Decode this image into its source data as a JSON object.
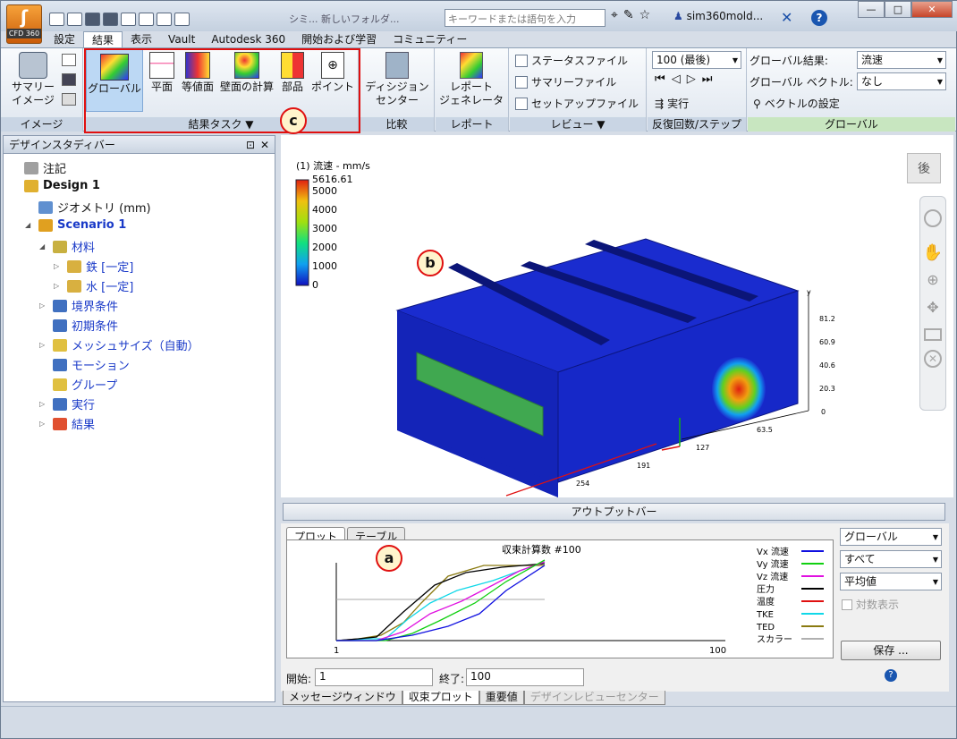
{
  "app": {
    "name": "CFD 360",
    "title_partial": "シミ... 新しいフォルダ..."
  },
  "search": {
    "placeholder": "キーワードまたは語句を入力"
  },
  "user": {
    "name": "sim360mold..."
  },
  "menu": [
    {
      "label": "設定"
    },
    {
      "label": "結果"
    },
    {
      "label": "表示"
    },
    {
      "label": "Vault"
    },
    {
      "label": "Autodesk 360"
    },
    {
      "label": "開始および学習"
    },
    {
      "label": "コミュニティー"
    }
  ],
  "ribbon": {
    "image_group": {
      "label": "イメージ",
      "summary_btn": "サマリー\nイメージ",
      "summary_l1": "サマリー",
      "summary_l2": "イメージ"
    },
    "result_tasks": {
      "label": "結果タスク ▼",
      "buttons": [
        "グローバル",
        "平面",
        "等値面",
        "壁面の計算",
        "部品",
        "ポイント"
      ]
    },
    "compare": {
      "label": "比較",
      "btn_l1": "ディシジョン",
      "btn_l2": "センター"
    },
    "report": {
      "label": "レポート",
      "btn_l1": "レポート",
      "btn_l2": "ジェネレータ"
    },
    "review": {
      "label": "レビュー ▼",
      "items": [
        "ステータスファイル",
        "サマリーファイル",
        "セットアップファイル"
      ]
    },
    "iter": {
      "label": "反復回数/ステップ",
      "select": "100 (最後)",
      "run": "実行"
    },
    "global": {
      "label": "グローバル",
      "result_label": "グローバル結果:",
      "result_value": "流速",
      "vector_label": "グローバル ベクトル:",
      "vector_value": "なし",
      "vector_settings": "ベクトルの設定"
    }
  },
  "design_panel": {
    "title": "デザインスタディバー",
    "tree": [
      {
        "label": "注記",
        "level": 0,
        "bold": false,
        "blue": false,
        "tri": ""
      },
      {
        "label": "Design 1",
        "level": 0,
        "bold": true,
        "blue": false,
        "tri": ""
      },
      {
        "label": "ジオメトリ (mm)",
        "level": 1,
        "bold": false,
        "blue": false,
        "tri": ""
      },
      {
        "label": "Scenario 1",
        "level": 1,
        "bold": true,
        "blue": true,
        "tri": "◢"
      },
      {
        "label": "材料",
        "level": 2,
        "bold": false,
        "blue": true,
        "tri": "◢"
      },
      {
        "label": "鉄 [一定]",
        "level": 3,
        "bold": false,
        "blue": true,
        "tri": "▷"
      },
      {
        "label": "水 [一定]",
        "level": 3,
        "bold": false,
        "blue": true,
        "tri": "▷"
      },
      {
        "label": "境界条件",
        "level": 2,
        "bold": false,
        "blue": true,
        "tri": "▷"
      },
      {
        "label": "初期条件",
        "level": 2,
        "bold": false,
        "blue": true,
        "tri": ""
      },
      {
        "label": "メッシュサイズ（自動）",
        "level": 2,
        "bold": false,
        "blue": true,
        "tri": "▷"
      },
      {
        "label": "モーション",
        "level": 2,
        "bold": false,
        "blue": true,
        "tri": ""
      },
      {
        "label": "グループ",
        "level": 2,
        "bold": false,
        "blue": true,
        "tri": ""
      },
      {
        "label": "実行",
        "level": 2,
        "bold": false,
        "blue": true,
        "tri": "▷"
      },
      {
        "label": "結果",
        "level": 2,
        "bold": false,
        "blue": true,
        "tri": "▷"
      }
    ]
  },
  "viewport": {
    "legend_title": "(1) 流速 - mm/s",
    "legend_max": "5616.61",
    "legend_ticks": [
      "5000",
      "4000",
      "3000",
      "2000",
      "1000",
      "0"
    ],
    "axis_y_ticks": [
      "81.2",
      "60.9",
      "40.6",
      "20.3",
      "0"
    ],
    "axis_x_ticks": [
      "127",
      "63.5"
    ],
    "axis_z_ticks": [
      "254",
      "191"
    ],
    "axis_y_label": "y",
    "cube_face": "後"
  },
  "callouts": {
    "a": "a",
    "b": "b",
    "c": "c"
  },
  "output_bar": {
    "title": "アウトプットバー",
    "tabs": [
      "プロット",
      "テーブル"
    ],
    "plot_title": "収束計算数 #100",
    "x_start": "1",
    "x_end": "100",
    "legend": [
      {
        "name": "Vx 流速",
        "color": "#1010e0"
      },
      {
        "name": "Vy 流速",
        "color": "#10d010"
      },
      {
        "name": "Vz 流速",
        "color": "#e010e0"
      },
      {
        "name": "圧力",
        "color": "#000000"
      },
      {
        "name": "温度",
        "color": "#e01010"
      },
      {
        "name": "TKE",
        "color": "#10d8e8"
      },
      {
        "name": "TED",
        "color": "#8a7a10"
      },
      {
        "name": "スカラー",
        "color": "#b0b0b0"
      }
    ],
    "selects": [
      "グローバル",
      "すべて",
      "平均値"
    ],
    "log_label": "対数表示",
    "save": "保存 ...",
    "start_label": "開始:",
    "start_value": "1",
    "end_label": "終了:",
    "end_value": "100"
  },
  "bottom_tabs": [
    "メッセージウィンドウ",
    "収束プロット",
    "重要値",
    "デザインレビューセンター"
  ]
}
